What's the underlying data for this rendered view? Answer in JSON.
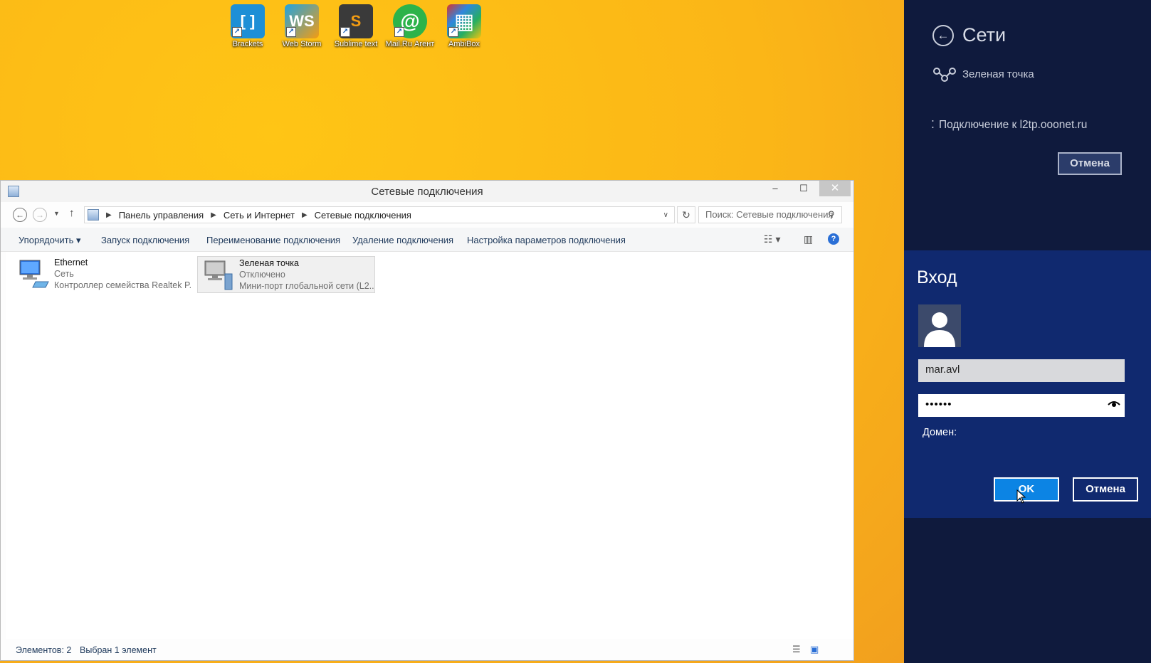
{
  "desktop": {
    "icons": [
      {
        "label": "Brackets",
        "color": "#1e8fd6",
        "glyph": "[ ]"
      },
      {
        "label": "Web Storm",
        "color": "#2b89d6",
        "glyph": "WS"
      },
      {
        "label": "Sublime text",
        "color": "#3a3a3a",
        "glyph": "S"
      },
      {
        "label": "Mail.Ru Агент",
        "color": "#2db34a",
        "glyph": "@"
      },
      {
        "label": "AmbiBox",
        "color": "#d7342e",
        "glyph": "▦"
      }
    ]
  },
  "window": {
    "title": "Сетевые подключения",
    "minimize": "–",
    "maximize": "☐",
    "close": "✕",
    "breadcrumb": [
      "Панель управления",
      "Сеть и Интернет",
      "Сетевые подключения"
    ],
    "search_placeholder": "Поиск: Сетевые подключения",
    "toolbar": {
      "organize": "Упорядочить ▾",
      "start": "Запуск подключения",
      "rename": "Переименование подключения",
      "delete": "Удаление подключения",
      "settings": "Настройка параметров подключения"
    },
    "items": [
      {
        "name": "Ethernet",
        "status": "Сеть",
        "device": "Контроллер семейства Realtek P...",
        "selected": false
      },
      {
        "name": "Зеленая точка",
        "status": "Отключено",
        "device": "Мини-порт глобальной сети (L2...",
        "selected": true
      }
    ],
    "status": {
      "count": "Элементов: 2",
      "selected": "Выбран 1 элемент"
    }
  },
  "charm": {
    "title": "Сети",
    "network": "Зеленая точка",
    "connecting": "Подключение к l2tp.ooonet.ru",
    "cancel": "Отмена",
    "login": {
      "title": "Вход",
      "username": "mar.avl",
      "password": "••••••",
      "domain_label": "Домен:",
      "ok": "OK",
      "cancel": "Отмена"
    }
  }
}
